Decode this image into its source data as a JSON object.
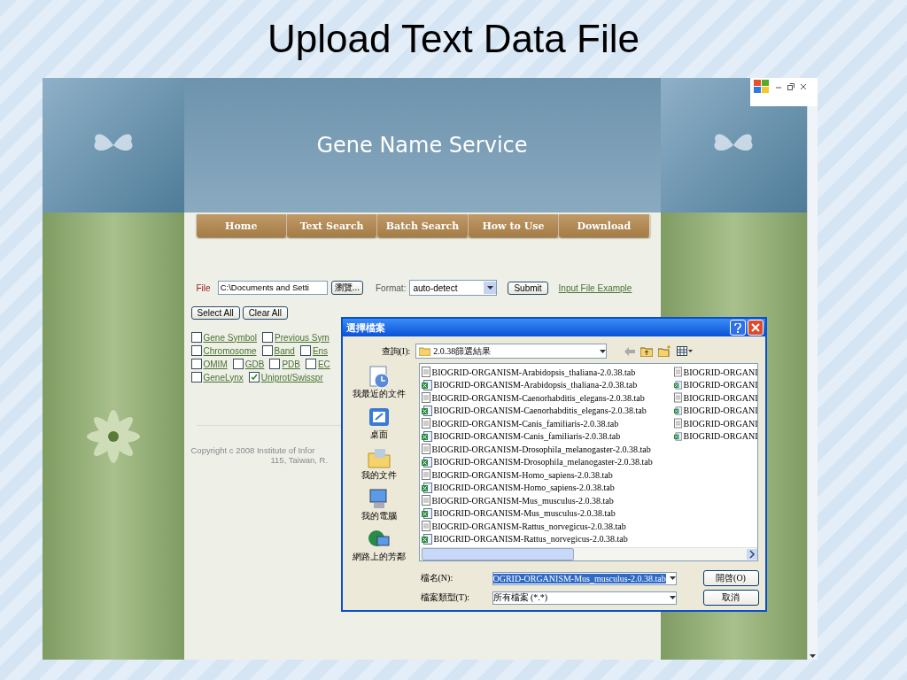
{
  "slide": {
    "title": "Upload Text Data File"
  },
  "site": {
    "title": "Gene Name Service",
    "nav": [
      "Home",
      "Text Search",
      "Batch Search",
      "How to Use",
      "Download"
    ],
    "form": {
      "file_label": "File",
      "file_value": "C:\\Documents and Setti",
      "browse_button": "瀏覽...",
      "format_label": "Format:",
      "format_value": "auto-detect",
      "submit_button": "Submit",
      "example_link": "Input File Example"
    },
    "buttons": [
      "Select All",
      "Clear All"
    ],
    "field_rows": [
      [
        {
          "label": "Gene Symbol",
          "checked": false
        },
        {
          "label": "Previous Sym",
          "checked": false
        }
      ],
      [
        {
          "label": "Chromosome",
          "checked": false
        },
        {
          "label": "Band",
          "checked": false
        },
        {
          "label": "Ens",
          "checked": false
        }
      ],
      [
        {
          "label": "OMIM",
          "checked": false
        },
        {
          "label": "GDB",
          "checked": false
        },
        {
          "label": "PDB",
          "checked": false
        },
        {
          "label": "EC",
          "checked": false
        }
      ],
      [
        {
          "label": "GeneLynx",
          "checked": false
        },
        {
          "label": "Uniprot/Swisspr",
          "checked": true
        }
      ]
    ],
    "footer": [
      "Copyright c 2008 Institute of Infor",
      "115, Taiwan, R."
    ]
  },
  "dialog": {
    "title": "選擇檔案",
    "look_in_label": "查詢(I):",
    "look_in_value": "2.0.38篩選結果",
    "places": [
      "我最近的文件",
      "桌面",
      "我的文件",
      "我的電腦",
      "網路上的芳鄰"
    ],
    "files": [
      {
        "name": "BIOGRID-ORGANISM-Arabidopsis_thaliana-2.0.38.tab",
        "kind": "text"
      },
      {
        "name": "BIOGRID-ORGANISM-Arabidopsis_thaliana-2.0.38.tab",
        "kind": "excel"
      },
      {
        "name": "BIOGRID-ORGANISM-Caenorhabditis_elegans-2.0.38.tab",
        "kind": "text"
      },
      {
        "name": "BIOGRID-ORGANISM-Caenorhabditis_elegans-2.0.38.tab",
        "kind": "excel"
      },
      {
        "name": "BIOGRID-ORGANISM-Canis_familiaris-2.0.38.tab",
        "kind": "text"
      },
      {
        "name": "BIOGRID-ORGANISM-Canis_familiaris-2.0.38.tab",
        "kind": "excel"
      },
      {
        "name": "BIOGRID-ORGANISM-Drosophila_melanogaster-2.0.38.tab",
        "kind": "text"
      },
      {
        "name": "BIOGRID-ORGANISM-Drosophila_melanogaster-2.0.38.tab",
        "kind": "excel"
      },
      {
        "name": "BIOGRID-ORGANISM-Homo_sapiens-2.0.38.tab",
        "kind": "text"
      },
      {
        "name": "BIOGRID-ORGANISM-Homo_sapiens-2.0.38.tab",
        "kind": "excel"
      },
      {
        "name": "BIOGRID-ORGANISM-Mus_musculus-2.0.38.tab",
        "kind": "text"
      },
      {
        "name": "BIOGRID-ORGANISM-Mus_musculus-2.0.38.tab",
        "kind": "excel"
      },
      {
        "name": "BIOGRID-ORGANISM-Rattus_norvegicus-2.0.38.tab",
        "kind": "text"
      },
      {
        "name": "BIOGRID-ORGANISM-Rattus_norvegicus-2.0.38.tab",
        "kind": "excel"
      },
      {
        "name": "BIOGRID-ORGANI",
        "kind": "text"
      },
      {
        "name": "BIOGRID-ORGANI",
        "kind": "excel"
      },
      {
        "name": "BIOGRID-ORGANI",
        "kind": "text"
      },
      {
        "name": "BIOGRID-ORGANI",
        "kind": "excel"
      },
      {
        "name": "BIOGRID-ORGANI",
        "kind": "text"
      },
      {
        "name": "BIOGRID-ORGANI",
        "kind": "excel"
      }
    ],
    "filename_label": "檔名(N):",
    "filename_value": "OGRID-ORGANISM-Mus_musculus-2.0.38.tab",
    "filetype_label": "檔案類型(T):",
    "filetype_value": "所有檔案 (*.*)",
    "open_button": "開啓(O)",
    "cancel_button": "取消"
  }
}
